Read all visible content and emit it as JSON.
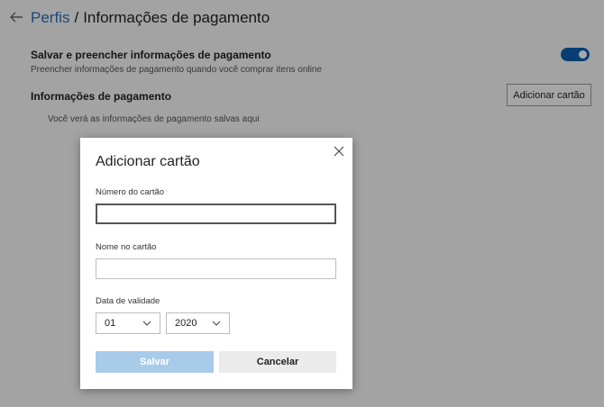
{
  "header": {
    "breadcrumb_parent": "Perfis",
    "separator": "/",
    "title": "Informações de pagamento"
  },
  "setting": {
    "title": "Salvar e preencher informações de pagamento",
    "description": "Preencher informações de pagamento quando você comprar itens online",
    "toggle_on": true
  },
  "payment_section": {
    "title": "Informações de pagamento",
    "add_card_label": "Adicionar cartão",
    "empty_note": "Você verá as informações de pagamento salvas aqui"
  },
  "dialog": {
    "title": "Adicionar cartão",
    "card_number_label": "Número do cartão",
    "card_number_value": "",
    "name_label": "Nome no cartão",
    "name_value": "",
    "expiry_label": "Data de validade",
    "month_value": "01",
    "year_value": "2020",
    "save_label": "Salvar",
    "cancel_label": "Cancelar"
  },
  "colors": {
    "accent": "#0f5fb0",
    "link": "#2b6fb3",
    "save_disabled": "#a8cbea"
  }
}
